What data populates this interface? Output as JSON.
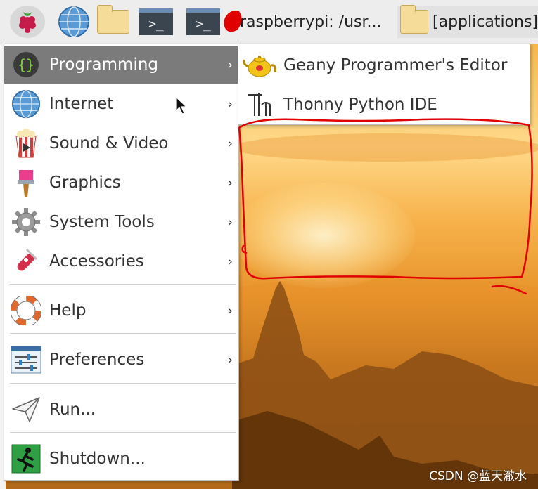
{
  "taskbar": {
    "terminal_task_label": "@raspberrypi: /usr...",
    "folder_task_label": "[applications]",
    "icons": [
      "raspberry-icon",
      "globe-icon",
      "folder-icon",
      "terminal-icon",
      "terminal-icon",
      "folder-icon"
    ]
  },
  "menu": {
    "items": [
      {
        "label": "Programming",
        "icon": "braces-icon",
        "has_submenu": true,
        "active": true
      },
      {
        "label": "Internet",
        "icon": "globe-icon",
        "has_submenu": true
      },
      {
        "label": "Sound & Video",
        "icon": "popcorn-icon",
        "has_submenu": true
      },
      {
        "label": "Graphics",
        "icon": "paintbrush-icon",
        "has_submenu": true
      },
      {
        "label": "System Tools",
        "icon": "gear-icon",
        "has_submenu": true
      },
      {
        "label": "Accessories",
        "icon": "swiss-knife-icon",
        "has_submenu": true
      },
      {
        "label": "Help",
        "icon": "lifebuoy-icon",
        "has_submenu": true
      },
      {
        "label": "Preferences",
        "icon": "sliders-icon",
        "has_submenu": true
      },
      {
        "label": "Run...",
        "icon": "paper-plane-icon",
        "has_submenu": false
      },
      {
        "label": "Shutdown...",
        "icon": "exit-icon",
        "has_submenu": false
      }
    ],
    "arrow": "›"
  },
  "submenu": {
    "items": [
      {
        "label": "Geany Programmer's Editor",
        "icon": "teapot-icon"
      },
      {
        "label": "Thonny Python IDE",
        "icon": "thonny-icon"
      }
    ]
  },
  "watermark": "CSDN @蓝天澈水",
  "colors": {
    "menu_active": "#7b7b7b",
    "annotation_red": "#e00000"
  }
}
